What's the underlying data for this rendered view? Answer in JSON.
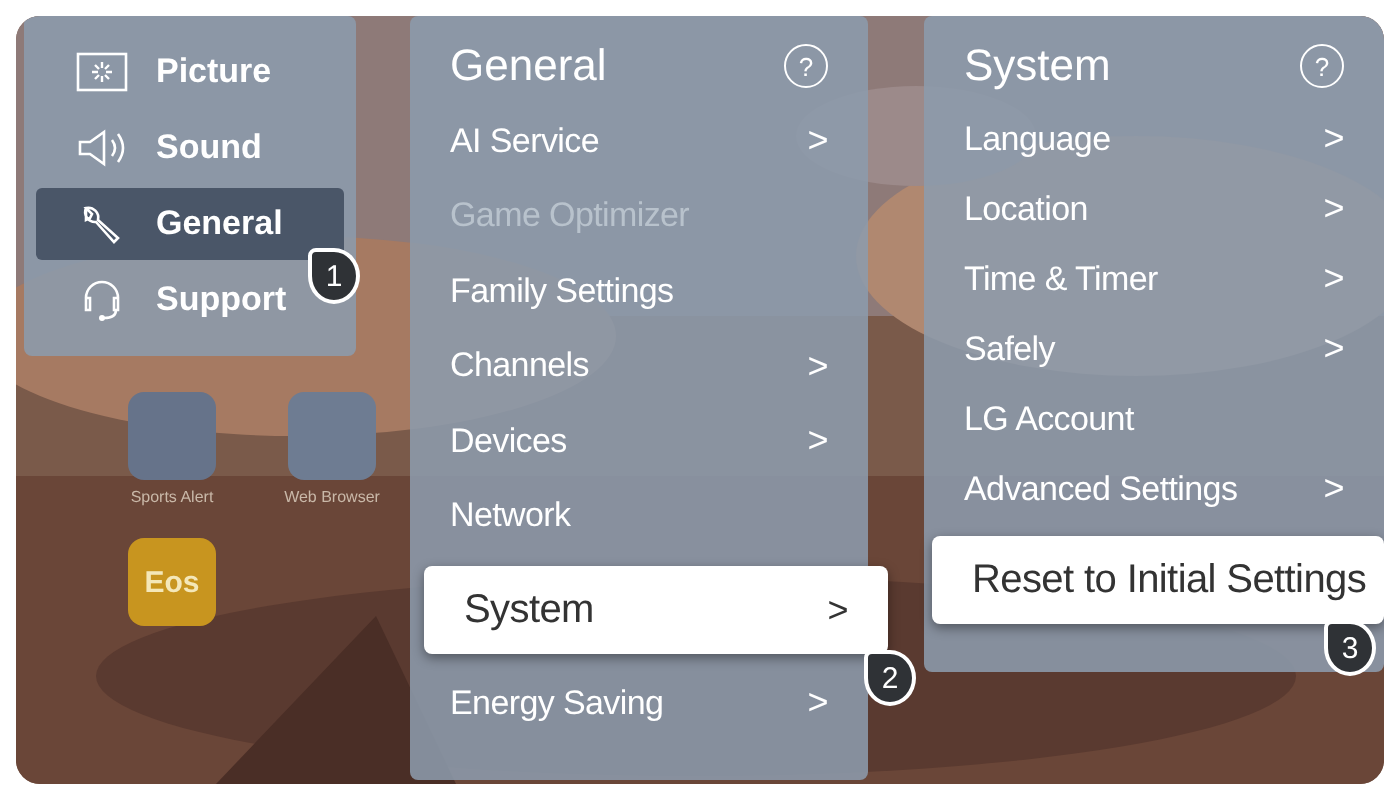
{
  "apps": [
    {
      "label": "Sports Alert",
      "color": "#66738a"
    },
    {
      "label": "Web Browser",
      "color": "#6e7c92"
    },
    {
      "tile": "Eos",
      "color": "#c8951f"
    }
  ],
  "menus": [
    {
      "kind": "categories",
      "items": [
        {
          "label": "Picture",
          "selected": false
        },
        {
          "label": "Sound",
          "selected": false
        },
        {
          "label": "General",
          "selected": true,
          "step": "1"
        },
        {
          "label": "Support",
          "selected": false
        }
      ]
    },
    {
      "kind": "list",
      "title": "General",
      "help": "?",
      "items": [
        {
          "label": "AI Service",
          "arrow": ">",
          "disabled": false,
          "selected": false
        },
        {
          "label": "Game Optimizer",
          "disabled": true,
          "selected": false
        },
        {
          "label": "Family Settings",
          "disabled": false,
          "selected": false
        },
        {
          "label": "Channels",
          "arrow": ">",
          "disabled": false,
          "selected": false
        },
        {
          "label": "Devices",
          "arrow": ">",
          "disabled": false,
          "selected": false
        },
        {
          "label": "Network",
          "disabled": false,
          "selected": false
        },
        {
          "label": "System",
          "arrow": ">",
          "disabled": false,
          "selected": true,
          "step": "2"
        },
        {
          "label": "Energy Saving",
          "arrow": ">",
          "disabled": false,
          "selected": false
        }
      ]
    },
    {
      "kind": "list",
      "title": "System",
      "help": "?",
      "items": [
        {
          "label": "Language",
          "arrow": ">",
          "disabled": false,
          "selected": false
        },
        {
          "label": "Location",
          "arrow": ">",
          "disabled": false,
          "selected": false
        },
        {
          "label": "Time & Timer",
          "arrow": ">",
          "disabled": false,
          "selected": false
        },
        {
          "label": "Safely",
          "arrow": ">",
          "disabled": false,
          "selected": false
        },
        {
          "label": "LG Account",
          "disabled": false,
          "selected": false
        },
        {
          "label": "Advanced Settings",
          "arrow": ">",
          "disabled": false,
          "selected": false
        },
        {
          "label": "Reset to Initial Settings",
          "disabled": false,
          "selected": true,
          "step": "3"
        }
      ]
    }
  ]
}
